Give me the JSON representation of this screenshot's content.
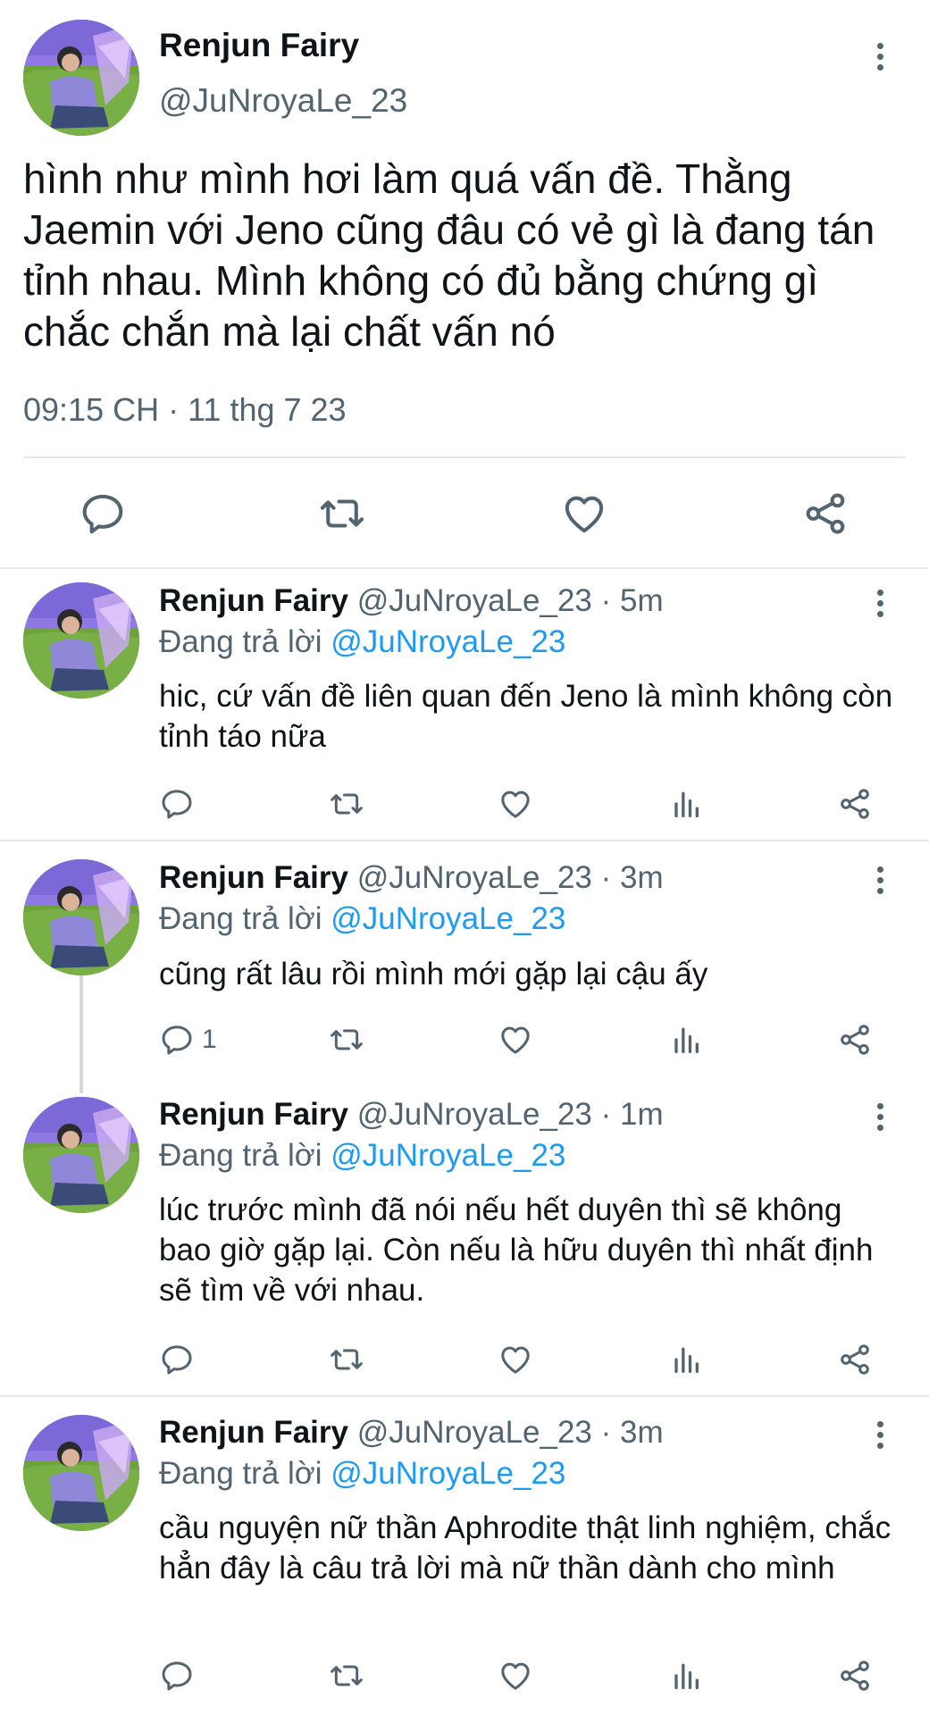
{
  "colors": {
    "text": "#0f1419",
    "muted": "#536471",
    "link": "#1d9bf0",
    "divider": "#e7eaec"
  },
  "main_tweet": {
    "name": "Renjun Fairy",
    "handle": "@JuNroyaLe_23",
    "text": "hình như mình hơi làm quá vấn đề. Thằng Jaemin với Jeno cũng đâu có vẻ gì là đang tán tỉnh nhau. Mình không có đủ bằng chứng gì chắc chắn mà lại chất vấn nó",
    "timestamp": "09:15 CH · 11 thg 7 23",
    "actions": [
      "reply-icon",
      "retweet-icon",
      "like-icon",
      "share-icon"
    ]
  },
  "replies": [
    {
      "name": "Renjun Fairy",
      "handle_time": "@JuNroyaLe_23 · 5m",
      "replying_prefix": "Đang trả lời",
      "replying_to": "@JuNroyaLe_23",
      "text": "hic, cứ vấn đề liên quan đến Jeno là mình không còn tỉnh táo nữa",
      "reply_count": ""
    },
    {
      "name": "Renjun Fairy",
      "handle_time": "@JuNroyaLe_23 · 3m",
      "replying_prefix": "Đang trả lời",
      "replying_to": "@JuNroyaLe_23",
      "text": "cũng rất lâu rồi mình mới gặp lại cậu ấy",
      "reply_count": "1"
    },
    {
      "name": "Renjun Fairy",
      "handle_time": "@JuNroyaLe_23 · 1m",
      "replying_prefix": "Đang trả lời",
      "replying_to": "@JuNroyaLe_23",
      "text": "lúc trước mình đã nói nếu hết duyên thì sẽ không bao giờ gặp lại. Còn nếu là hữu duyên thì nhất định sẽ tìm về với nhau.",
      "reply_count": ""
    },
    {
      "name": "Renjun Fairy",
      "handle_time": "@JuNroyaLe_23 · 3m",
      "replying_prefix": "Đang trả lời",
      "replying_to": "@JuNroyaLe_23",
      "text": "cầu nguyện nữ thần Aphrodite thật linh nghiệm, chắc hẳn đây là câu trả lời mà nữ thần dành cho mình",
      "reply_count": ""
    }
  ]
}
